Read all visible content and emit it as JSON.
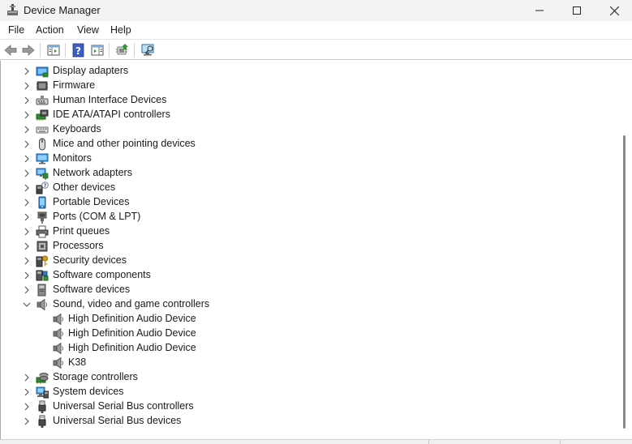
{
  "window": {
    "title": "Device Manager"
  },
  "menu": [
    "File",
    "Action",
    "View",
    "Help"
  ],
  "tree": [
    {
      "label": "Display adapters",
      "icon": "display-adapter-icon",
      "expanded": false
    },
    {
      "label": "Firmware",
      "icon": "firmware-icon",
      "expanded": false
    },
    {
      "label": "Human Interface Devices",
      "icon": "hid-icon",
      "expanded": false
    },
    {
      "label": "IDE ATA/ATAPI controllers",
      "icon": "ide-controller-icon",
      "expanded": false
    },
    {
      "label": "Keyboards",
      "icon": "keyboard-icon",
      "expanded": false
    },
    {
      "label": "Mice and other pointing devices",
      "icon": "mouse-icon",
      "expanded": false
    },
    {
      "label": "Monitors",
      "icon": "monitor-icon",
      "expanded": false
    },
    {
      "label": "Network adapters",
      "icon": "network-adapter-icon",
      "expanded": false
    },
    {
      "label": "Other devices",
      "icon": "unknown-device-icon",
      "expanded": false
    },
    {
      "label": "Portable Devices",
      "icon": "portable-device-icon",
      "expanded": false
    },
    {
      "label": "Ports (COM & LPT)",
      "icon": "port-icon",
      "expanded": false
    },
    {
      "label": "Print queues",
      "icon": "printer-icon",
      "expanded": false
    },
    {
      "label": "Processors",
      "icon": "processor-icon",
      "expanded": false
    },
    {
      "label": "Security devices",
      "icon": "security-device-icon",
      "expanded": false
    },
    {
      "label": "Software components",
      "icon": "software-component-icon",
      "expanded": false
    },
    {
      "label": "Software devices",
      "icon": "software-device-icon",
      "expanded": false
    },
    {
      "label": "Sound, video and game controllers",
      "icon": "speaker-icon",
      "expanded": true,
      "children": [
        {
          "label": "High Definition Audio Device",
          "icon": "speaker-icon"
        },
        {
          "label": "High Definition Audio Device",
          "icon": "speaker-icon"
        },
        {
          "label": "High Definition Audio Device",
          "icon": "speaker-icon"
        },
        {
          "label": "K38",
          "icon": "speaker-icon"
        }
      ]
    },
    {
      "label": "Storage controllers",
      "icon": "storage-controller-icon",
      "expanded": false
    },
    {
      "label": "System devices",
      "icon": "system-device-icon",
      "expanded": false
    },
    {
      "label": "Universal Serial Bus controllers",
      "icon": "usb-icon",
      "expanded": false
    },
    {
      "label": "Universal Serial Bus devices",
      "icon": "usb-icon",
      "expanded": false
    }
  ]
}
